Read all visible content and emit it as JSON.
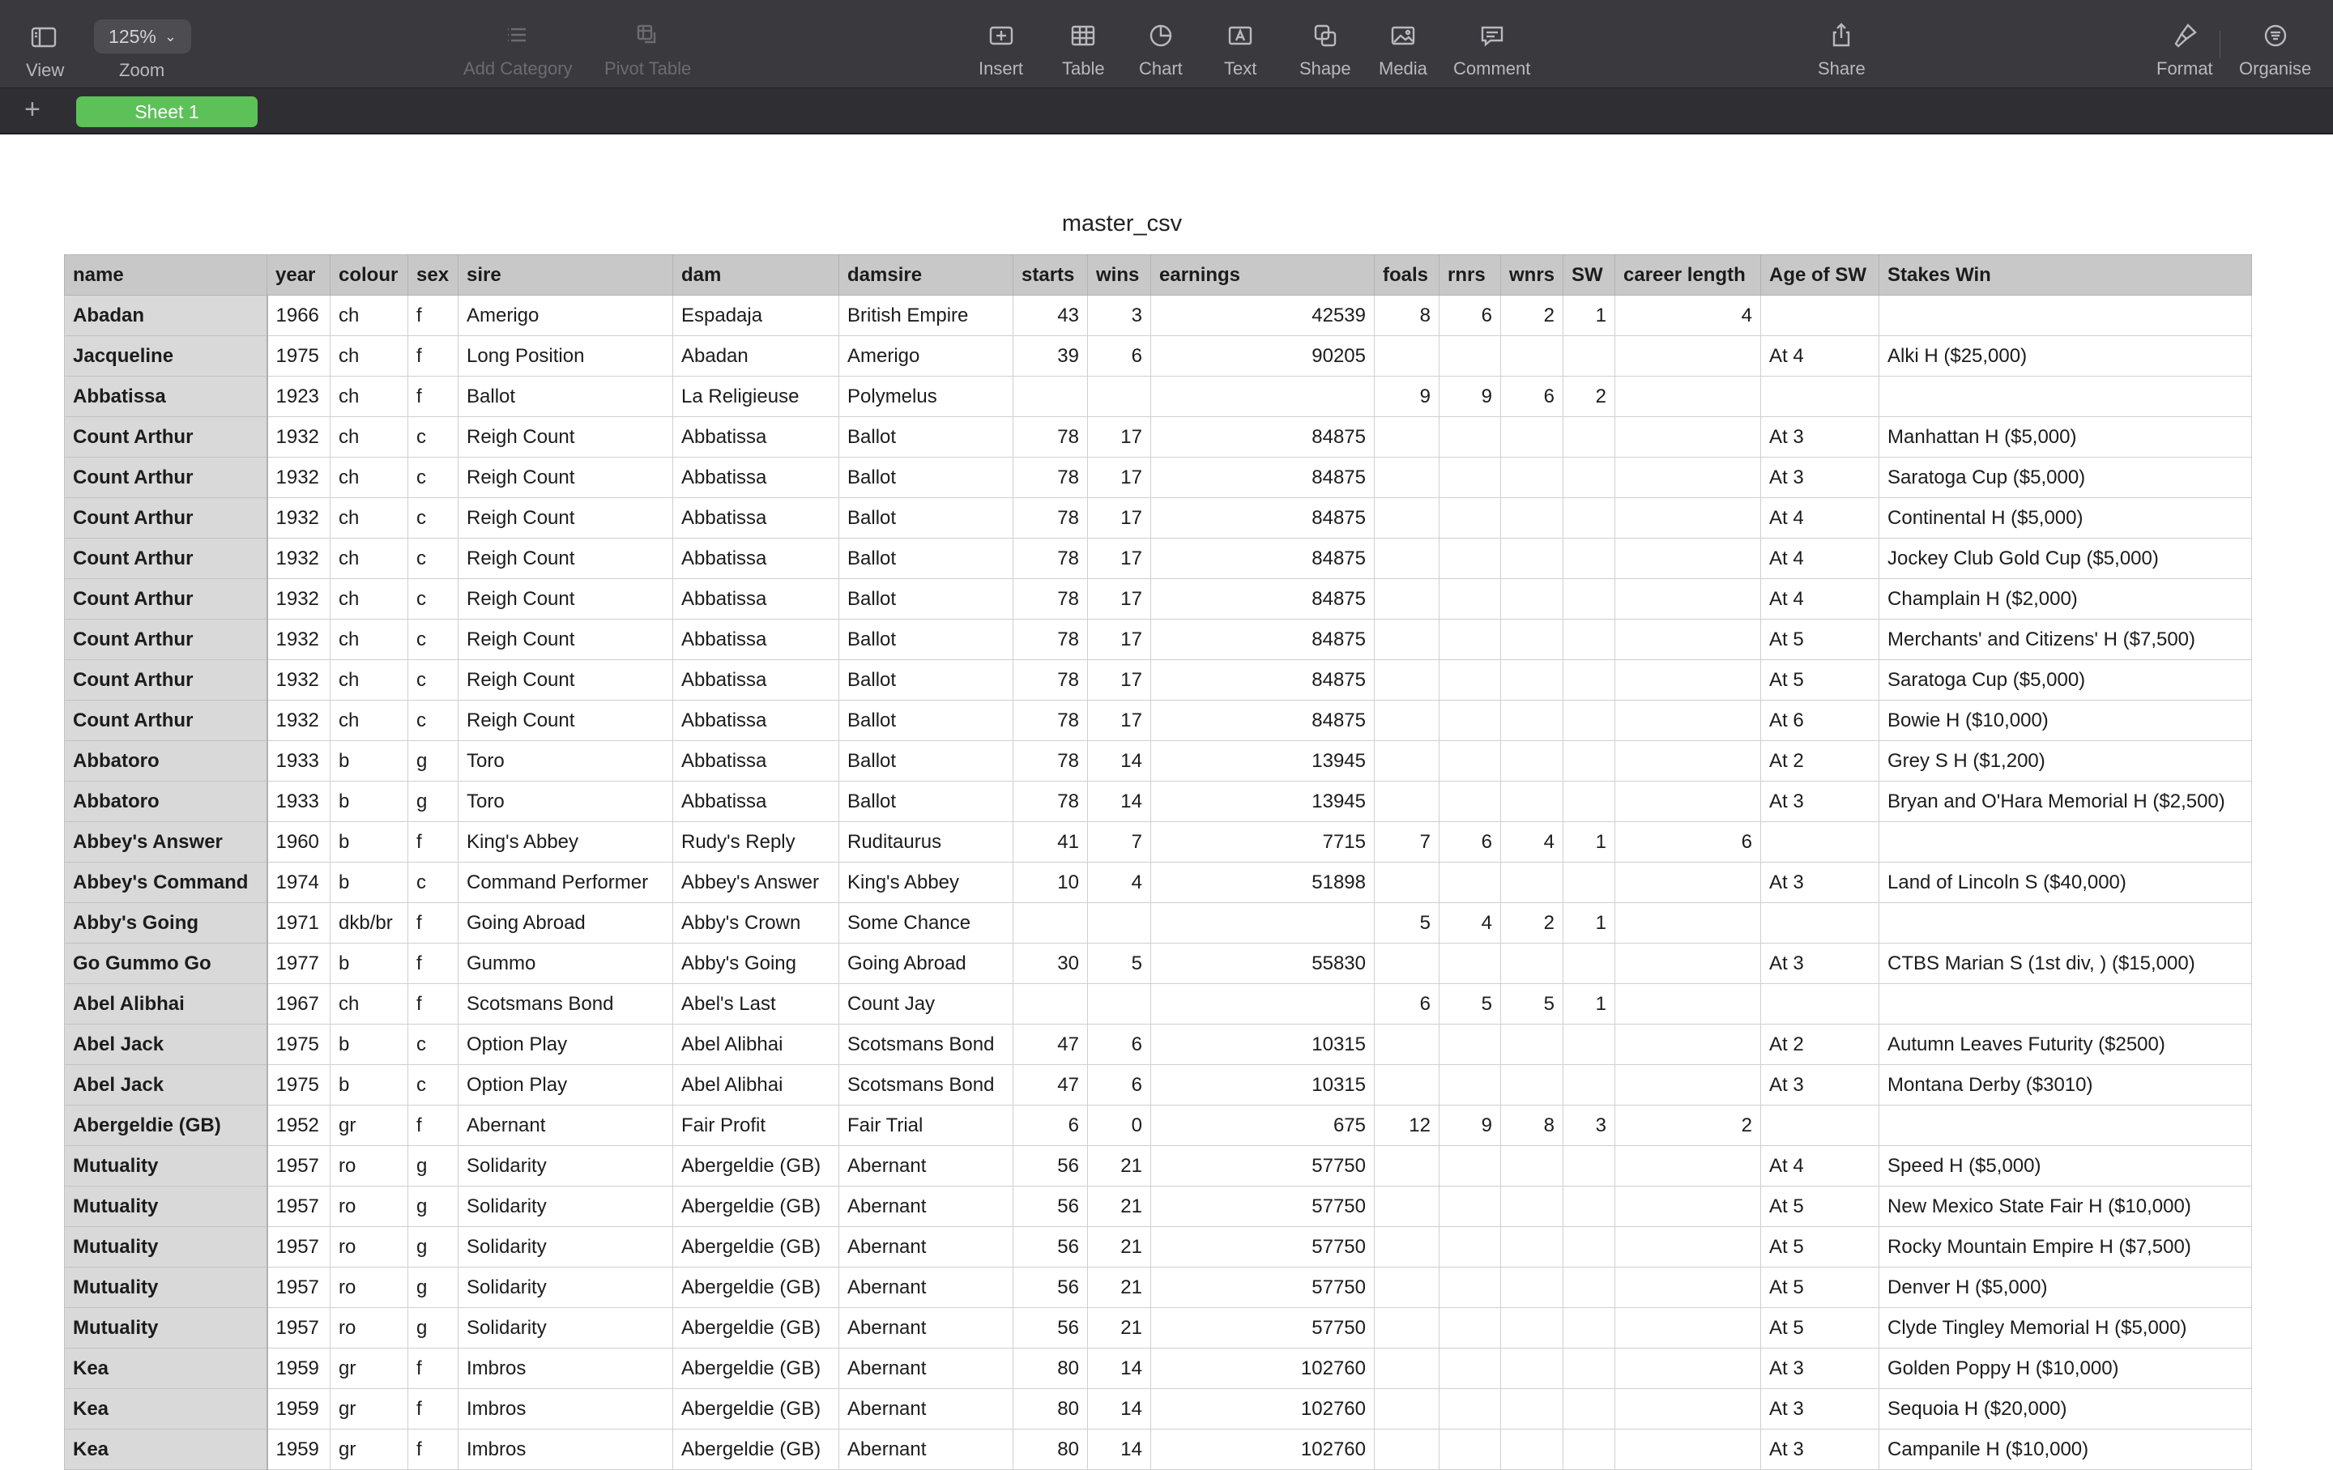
{
  "toolbar": {
    "view_label": "View",
    "zoom_value": "125%",
    "zoom_label": "Zoom",
    "add_category_label": "Add Category",
    "pivot_table_label": "Pivot Table",
    "insert_label": "Insert",
    "table_label": "Table",
    "chart_label": "Chart",
    "text_label": "Text",
    "shape_label": "Shape",
    "media_label": "Media",
    "comment_label": "Comment",
    "share_label": "Share",
    "format_label": "Format",
    "organise_label": "Organise"
  },
  "sheets": {
    "add_symbol": "+",
    "active_tab": "Sheet 1"
  },
  "table": {
    "title": "master_csv",
    "columns": [
      "name",
      "year",
      "colour",
      "sex",
      "sire",
      "dam",
      "damsire",
      "starts",
      "wins",
      "earnings",
      "foals",
      "rnrs",
      "wnrs",
      "SW",
      "career length",
      "Age of SW",
      "Stakes Win"
    ],
    "rows": [
      [
        "Abadan",
        "1966",
        "ch",
        "f",
        "Amerigo",
        "Espadaja",
        "British Empire",
        "43",
        "3",
        "42539",
        "8",
        "6",
        "2",
        "1",
        "4",
        "",
        ""
      ],
      [
        "Jacqueline",
        "1975",
        "ch",
        "f",
        "Long Position",
        "Abadan",
        "Amerigo",
        "39",
        "6",
        "90205",
        "",
        "",
        "",
        "",
        "",
        "At 4",
        "Alki H ($25,000)"
      ],
      [
        "Abbatissa",
        "1923",
        "ch",
        "f",
        "Ballot",
        "La Religieuse",
        "Polymelus",
        "",
        "",
        "",
        "9",
        "9",
        "6",
        "2",
        "",
        "",
        ""
      ],
      [
        "Count Arthur",
        "1932",
        "ch",
        "c",
        "Reigh Count",
        "Abbatissa",
        "Ballot",
        "78",
        "17",
        "84875",
        "",
        "",
        "",
        "",
        "",
        "At 3",
        "Manhattan H ($5,000)"
      ],
      [
        "Count Arthur",
        "1932",
        "ch",
        "c",
        "Reigh Count",
        "Abbatissa",
        "Ballot",
        "78",
        "17",
        "84875",
        "",
        "",
        "",
        "",
        "",
        "At 3",
        "Saratoga Cup ($5,000)"
      ],
      [
        "Count Arthur",
        "1932",
        "ch",
        "c",
        "Reigh Count",
        "Abbatissa",
        "Ballot",
        "78",
        "17",
        "84875",
        "",
        "",
        "",
        "",
        "",
        "At 4",
        "Continental H ($5,000)"
      ],
      [
        "Count Arthur",
        "1932",
        "ch",
        "c",
        "Reigh Count",
        "Abbatissa",
        "Ballot",
        "78",
        "17",
        "84875",
        "",
        "",
        "",
        "",
        "",
        "At 4",
        "Jockey Club Gold Cup ($5,000)"
      ],
      [
        "Count Arthur",
        "1932",
        "ch",
        "c",
        "Reigh Count",
        "Abbatissa",
        "Ballot",
        "78",
        "17",
        "84875",
        "",
        "",
        "",
        "",
        "",
        "At 4",
        "Champlain H ($2,000)"
      ],
      [
        "Count Arthur",
        "1932",
        "ch",
        "c",
        "Reigh Count",
        "Abbatissa",
        "Ballot",
        "78",
        "17",
        "84875",
        "",
        "",
        "",
        "",
        "",
        "At 5",
        "Merchants' and Citizens' H ($7,500)"
      ],
      [
        "Count Arthur",
        "1932",
        "ch",
        "c",
        "Reigh Count",
        "Abbatissa",
        "Ballot",
        "78",
        "17",
        "84875",
        "",
        "",
        "",
        "",
        "",
        "At 5",
        "Saratoga Cup ($5,000)"
      ],
      [
        "Count Arthur",
        "1932",
        "ch",
        "c",
        "Reigh Count",
        "Abbatissa",
        "Ballot",
        "78",
        "17",
        "84875",
        "",
        "",
        "",
        "",
        "",
        "At 6",
        "Bowie H ($10,000)"
      ],
      [
        "Abbatoro",
        "1933",
        "b",
        "g",
        "Toro",
        "Abbatissa",
        "Ballot",
        "78",
        "14",
        "13945",
        "",
        "",
        "",
        "",
        "",
        "At 2",
        "Grey S H ($1,200)"
      ],
      [
        "Abbatoro",
        "1933",
        "b",
        "g",
        "Toro",
        "Abbatissa",
        "Ballot",
        "78",
        "14",
        "13945",
        "",
        "",
        "",
        "",
        "",
        "At 3",
        "Bryan and O'Hara Memorial H ($2,500)"
      ],
      [
        "Abbey's Answer",
        "1960",
        "b",
        "f",
        "King's Abbey",
        "Rudy's Reply",
        "Ruditaurus",
        "41",
        "7",
        "7715",
        "7",
        "6",
        "4",
        "1",
        "6",
        "",
        ""
      ],
      [
        "Abbey's Command",
        "1974",
        "b",
        "c",
        "Command Performer",
        "Abbey's Answer",
        "King's Abbey",
        "10",
        "4",
        "51898",
        "",
        "",
        "",
        "",
        "",
        "At 3",
        "Land of Lincoln S ($40,000)"
      ],
      [
        "Abby's Going",
        "1971",
        "dkb/br",
        "f",
        "Going Abroad",
        "Abby's Crown",
        "Some Chance",
        "",
        "",
        "",
        "5",
        "4",
        "2",
        "1",
        "",
        "",
        ""
      ],
      [
        "Go Gummo Go",
        "1977",
        "b",
        "f",
        "Gummo",
        "Abby's Going",
        "Going Abroad",
        "30",
        "5",
        "55830",
        "",
        "",
        "",
        "",
        "",
        "At 3",
        "CTBS Marian S (1st div, ) ($15,000)"
      ],
      [
        "Abel Alibhai",
        "1967",
        "ch",
        "f",
        "Scotsmans Bond",
        "Abel's Last",
        "Count Jay",
        "",
        "",
        "",
        "6",
        "5",
        "5",
        "1",
        "",
        "",
        ""
      ],
      [
        "Abel Jack",
        "1975",
        "b",
        "c",
        "Option Play",
        "Abel Alibhai",
        "Scotsmans Bond",
        "47",
        "6",
        "10315",
        "",
        "",
        "",
        "",
        "",
        "At 2",
        "Autumn Leaves Futurity ($2500)"
      ],
      [
        "Abel Jack",
        "1975",
        "b",
        "c",
        "Option Play",
        "Abel Alibhai",
        "Scotsmans Bond",
        "47",
        "6",
        "10315",
        "",
        "",
        "",
        "",
        "",
        "At 3",
        "Montana Derby ($3010)"
      ],
      [
        "Abergeldie (GB)",
        "1952",
        "gr",
        "f",
        "Abernant",
        "Fair Profit",
        "Fair Trial",
        "6",
        "0",
        "675",
        "12",
        "9",
        "8",
        "3",
        "2",
        "",
        ""
      ],
      [
        "Mutuality",
        "1957",
        "ro",
        "g",
        "Solidarity",
        "Abergeldie (GB)",
        "Abernant",
        "56",
        "21",
        "57750",
        "",
        "",
        "",
        "",
        "",
        "At 4",
        "Speed H ($5,000)"
      ],
      [
        "Mutuality",
        "1957",
        "ro",
        "g",
        "Solidarity",
        "Abergeldie (GB)",
        "Abernant",
        "56",
        "21",
        "57750",
        "",
        "",
        "",
        "",
        "",
        "At 5",
        "New Mexico State Fair H ($10,000)"
      ],
      [
        "Mutuality",
        "1957",
        "ro",
        "g",
        "Solidarity",
        "Abergeldie (GB)",
        "Abernant",
        "56",
        "21",
        "57750",
        "",
        "",
        "",
        "",
        "",
        "At 5",
        "Rocky Mountain Empire H ($7,500)"
      ],
      [
        "Mutuality",
        "1957",
        "ro",
        "g",
        "Solidarity",
        "Abergeldie (GB)",
        "Abernant",
        "56",
        "21",
        "57750",
        "",
        "",
        "",
        "",
        "",
        "At 5",
        "Denver H ($5,000)"
      ],
      [
        "Mutuality",
        "1957",
        "ro",
        "g",
        "Solidarity",
        "Abergeldie (GB)",
        "Abernant",
        "56",
        "21",
        "57750",
        "",
        "",
        "",
        "",
        "",
        "At 5",
        "Clyde Tingley Memorial H ($5,000)"
      ],
      [
        "Kea",
        "1959",
        "gr",
        "f",
        "Imbros",
        "Abergeldie (GB)",
        "Abernant",
        "80",
        "14",
        "102760",
        "",
        "",
        "",
        "",
        "",
        "At 3",
        "Golden Poppy H ($10,000)"
      ],
      [
        "Kea",
        "1959",
        "gr",
        "f",
        "Imbros",
        "Abergeldie (GB)",
        "Abernant",
        "80",
        "14",
        "102760",
        "",
        "",
        "",
        "",
        "",
        "At 3",
        "Sequoia H ($20,000)"
      ],
      [
        "Kea",
        "1959",
        "gr",
        "f",
        "Imbros",
        "Abergeldie (GB)",
        "Abernant",
        "80",
        "14",
        "102760",
        "",
        "",
        "",
        "",
        "",
        "At 3",
        "Campanile H ($10,000)"
      ]
    ]
  },
  "colors": {
    "toolbar_bg": "#3a393e",
    "sheet_tab": "#5dc159",
    "header_bg": "#c8c8c8"
  }
}
